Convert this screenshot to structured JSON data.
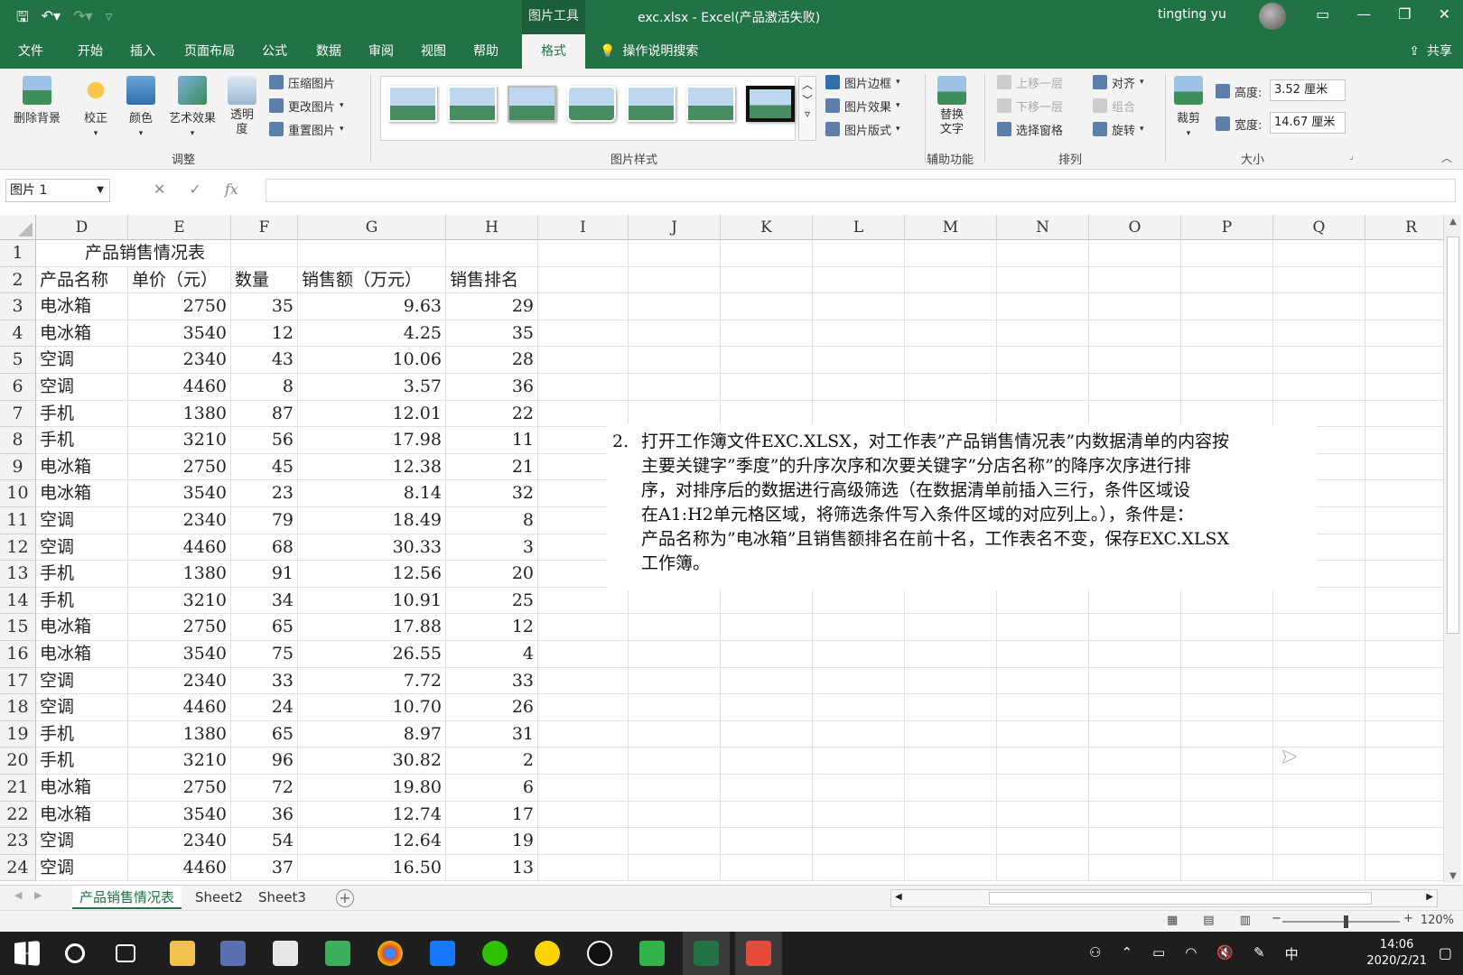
{
  "titlebar": {
    "context_tab": "图片工具",
    "doc_title": "exc.xlsx  -  Excel(产品激活失败)",
    "user": "tingting yu"
  },
  "menu": {
    "tabs": [
      "文件",
      "开始",
      "插入",
      "页面布局",
      "公式",
      "数据",
      "审阅",
      "视图",
      "帮助",
      "格式"
    ],
    "search": "操作说明搜索",
    "share": "共享"
  },
  "ribbon": {
    "adjust": {
      "remove_bg": "删除背景",
      "correct": "校正",
      "color": "颜色",
      "art": "艺术效果",
      "transparency": "透明度",
      "compress": "压缩图片",
      "change": "更改图片",
      "reset": "重置图片",
      "label": "调整"
    },
    "styles": {
      "border": "图片边框",
      "effects": "图片效果",
      "layout": "图片版式",
      "label": "图片样式"
    },
    "accessibility": {
      "alt_text": "替换文字",
      "label": "辅助功能"
    },
    "arrange": {
      "bring_forward": "上移一层",
      "send_backward": "下移一层",
      "selection_pane": "选择窗格",
      "align": "对齐",
      "group": "组合",
      "rotate": "旋转",
      "label": "排列"
    },
    "size": {
      "crop": "裁剪",
      "height_label": "高度:",
      "height_value": "3.52 厘米",
      "width_label": "宽度:",
      "width_value": "14.67 厘米",
      "label": "大小"
    }
  },
  "formula_bar": {
    "name_box": "图片 1",
    "fx": "fx",
    "value": ""
  },
  "columns": [
    "D",
    "E",
    "F",
    "G",
    "H",
    "I",
    "J",
    "K",
    "L",
    "M",
    "N",
    "O",
    "P",
    "Q",
    "R"
  ],
  "sheet": {
    "title": "产品销售情况表",
    "headers": [
      "产品名称",
      "单价（元）",
      "数量",
      "销售额（万元）",
      "销售排名"
    ],
    "rows": [
      [
        "电冰箱",
        "2750",
        "35",
        "9.63",
        "29"
      ],
      [
        "电冰箱",
        "3540",
        "12",
        "4.25",
        "35"
      ],
      [
        "空调",
        "2340",
        "43",
        "10.06",
        "28"
      ],
      [
        "空调",
        "4460",
        "8",
        "3.57",
        "36"
      ],
      [
        "手机",
        "1380",
        "87",
        "12.01",
        "22"
      ],
      [
        "手机",
        "3210",
        "56",
        "17.98",
        "11"
      ],
      [
        "电冰箱",
        "2750",
        "45",
        "12.38",
        "21"
      ],
      [
        "电冰箱",
        "3540",
        "23",
        "8.14",
        "32"
      ],
      [
        "空调",
        "2340",
        "79",
        "18.49",
        "8"
      ],
      [
        "空调",
        "4460",
        "68",
        "30.33",
        "3"
      ],
      [
        "手机",
        "1380",
        "91",
        "12.56",
        "20"
      ],
      [
        "手机",
        "3210",
        "34",
        "10.91",
        "25"
      ],
      [
        "电冰箱",
        "2750",
        "65",
        "17.88",
        "12"
      ],
      [
        "电冰箱",
        "3540",
        "75",
        "26.55",
        "4"
      ],
      [
        "空调",
        "2340",
        "33",
        "7.72",
        "33"
      ],
      [
        "空调",
        "4460",
        "24",
        "10.70",
        "26"
      ],
      [
        "手机",
        "1380",
        "65",
        "8.97",
        "31"
      ],
      [
        "手机",
        "3210",
        "96",
        "30.82",
        "2"
      ],
      [
        "电冰箱",
        "2750",
        "72",
        "19.80",
        "6"
      ],
      [
        "电冰箱",
        "3540",
        "36",
        "12.74",
        "17"
      ],
      [
        "空调",
        "2340",
        "54",
        "12.64",
        "19"
      ],
      [
        "空调",
        "4460",
        "37",
        "16.50",
        "13"
      ]
    ]
  },
  "textbox": {
    "number": "2.",
    "lines": [
      "打开工作簿文件EXC.XLSX，对工作表”产品销售情况表”内数据清单的内容按",
      "主要关键字”季度”的升序次序和次要关键字”分店名称”的降序次序进行排",
      "序，对排序后的数据进行高级筛选（在数据清单前插入三行，条件区域设",
      "在A1:H2单元格区域，将筛选条件写入条件区域的对应列上。），条件是：",
      "产品名称为”电冰箱”且销售额排名在前十名，工作表名不变，保存EXC.XLSX",
      "工作簿。"
    ]
  },
  "sheet_tabs": [
    "产品销售情况表",
    "Sheet2",
    "Sheet3"
  ],
  "status": {
    "zoom": "120%"
  },
  "taskbar": {
    "time": "14:06",
    "date": "2020/2/21",
    "ime": "中"
  }
}
